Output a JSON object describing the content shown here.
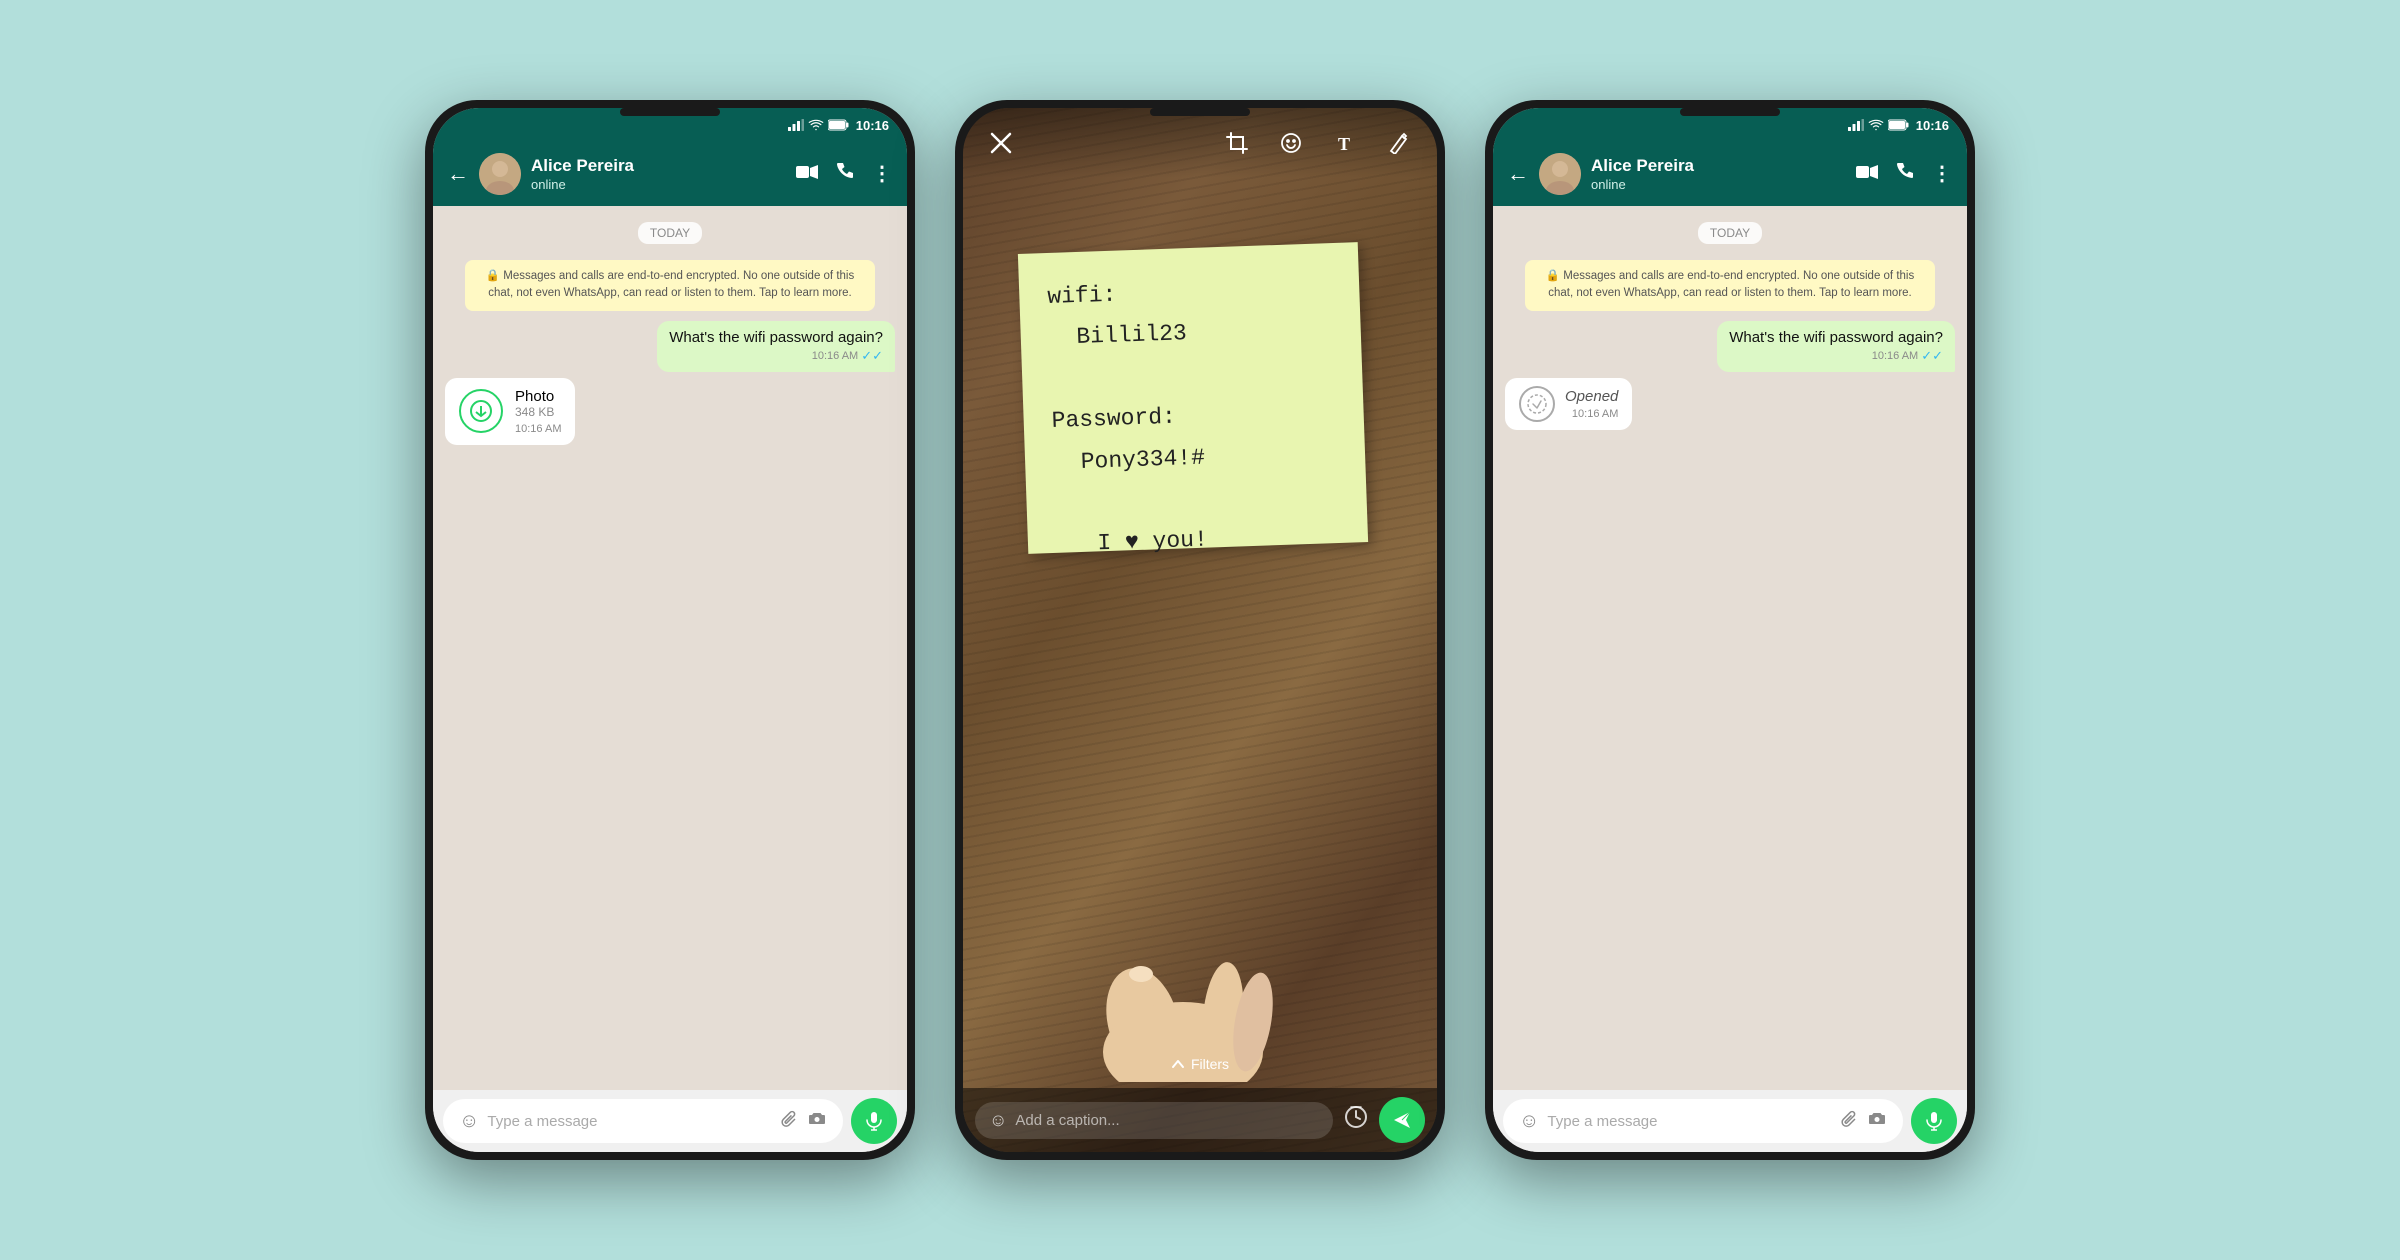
{
  "bg_color": "#b2dfdb",
  "phone1": {
    "status_bar": {
      "time": "10:16",
      "icons": [
        "signal",
        "wifi",
        "battery"
      ]
    },
    "header": {
      "contact_name": "Alice Pereira",
      "contact_status": "online",
      "icons": [
        "video",
        "phone",
        "more"
      ]
    },
    "chat": {
      "date_badge": "TODAY",
      "encryption_notice": "🔒 Messages and calls are end-to-end encrypted. No one outside of this chat, not even WhatsApp, can read or listen to them. Tap to learn more.",
      "message_out_text": "What's the wifi password again?",
      "message_out_time": "10:16 AM",
      "photo_label": "Photo",
      "photo_size": "348 KB",
      "photo_time": "10:16 AM"
    },
    "input": {
      "placeholder": "Type a message"
    }
  },
  "phone2": {
    "editor_tools": [
      "close",
      "crop",
      "emoji",
      "text",
      "draw"
    ],
    "sticky_note_text": "wifi:\nBillil23\n\nPassword:\nPony334!#\n\nI ♥ you!",
    "filters_label": "Filters",
    "caption_placeholder": "Add a caption...",
    "send_label": "Send"
  },
  "phone3": {
    "status_bar": {
      "time": "10:16",
      "icons": [
        "signal",
        "wifi",
        "battery"
      ]
    },
    "header": {
      "contact_name": "Alice Pereira",
      "contact_status": "online",
      "icons": [
        "video",
        "phone",
        "more"
      ]
    },
    "chat": {
      "date_badge": "TODAY",
      "encryption_notice": "🔒 Messages and calls are end-to-end encrypted. No one outside of this chat, not even WhatsApp, can read or listen to them. Tap to learn more.",
      "message_out_text": "What's the wifi password again?",
      "message_out_time": "10:16 AM",
      "opened_label": "Opened",
      "opened_time": "10:16 AM"
    },
    "input": {
      "placeholder": "Type a message"
    }
  }
}
